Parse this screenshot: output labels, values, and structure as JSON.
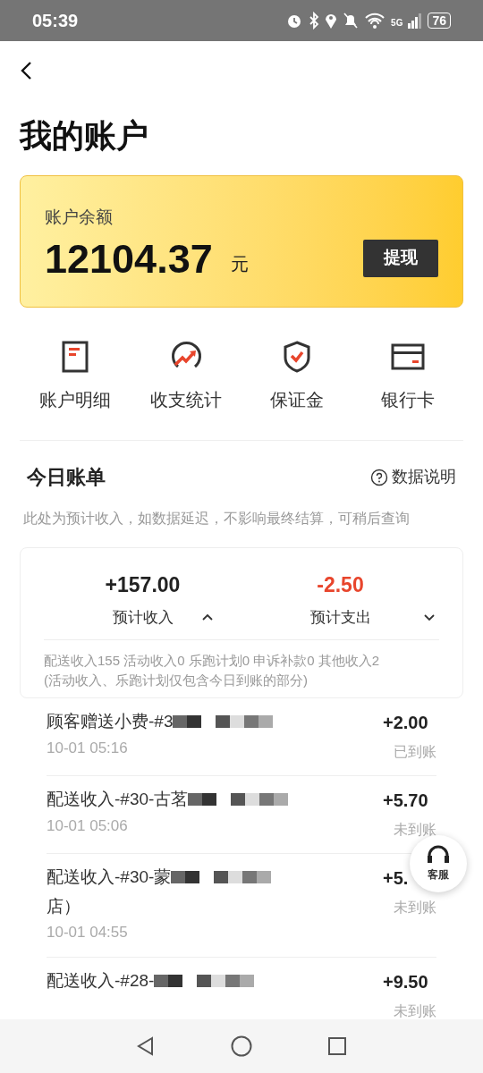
{
  "status_bar": {
    "time": "05:39",
    "battery": "76",
    "network": "5G"
  },
  "title": "我的账户",
  "balance_card": {
    "label": "账户余额",
    "amount": "12104.37",
    "unit": "元",
    "button": "提现"
  },
  "shortcuts": [
    {
      "kind": "statement",
      "label": "账户明细"
    },
    {
      "kind": "stats",
      "label": "收支统计"
    },
    {
      "kind": "deposit",
      "label": "保证金"
    },
    {
      "kind": "card",
      "label": "银行卡"
    }
  ],
  "bill": {
    "title": "今日账单",
    "help": "数据说明",
    "note": "此处为预计收入，如数据延迟，不影响最终结算，可稍后查询",
    "income": {
      "amount": "+157.00",
      "label": "预计收入",
      "expanded": true
    },
    "expense": {
      "amount": "-2.50",
      "label": "预计支出",
      "expanded": false
    },
    "breakdown": [
      "配送收入155 活动收入0 乐跑计划0 申诉补款0 其他收入2",
      "(活动收入、乐跑计划仅包含今日到账的部分)"
    ]
  },
  "transactions": [
    {
      "title": "顾客赠送小费-#3",
      "time": "10-01 05:16",
      "amount": "+2.00",
      "status": "已到账"
    },
    {
      "title": "配送收入-#30-古茗",
      "time": "10-01 05:06",
      "amount": "+5.70",
      "status": "未到账"
    },
    {
      "title": "配送收入-#30-蒙",
      "extra_line": "店）",
      "time": "10-01 04:55",
      "amount": "+5.",
      "status": "未到账"
    },
    {
      "title": "配送收入-#28-",
      "amount": "+9.50",
      "status": "未到账"
    }
  ],
  "support_button": "客服"
}
